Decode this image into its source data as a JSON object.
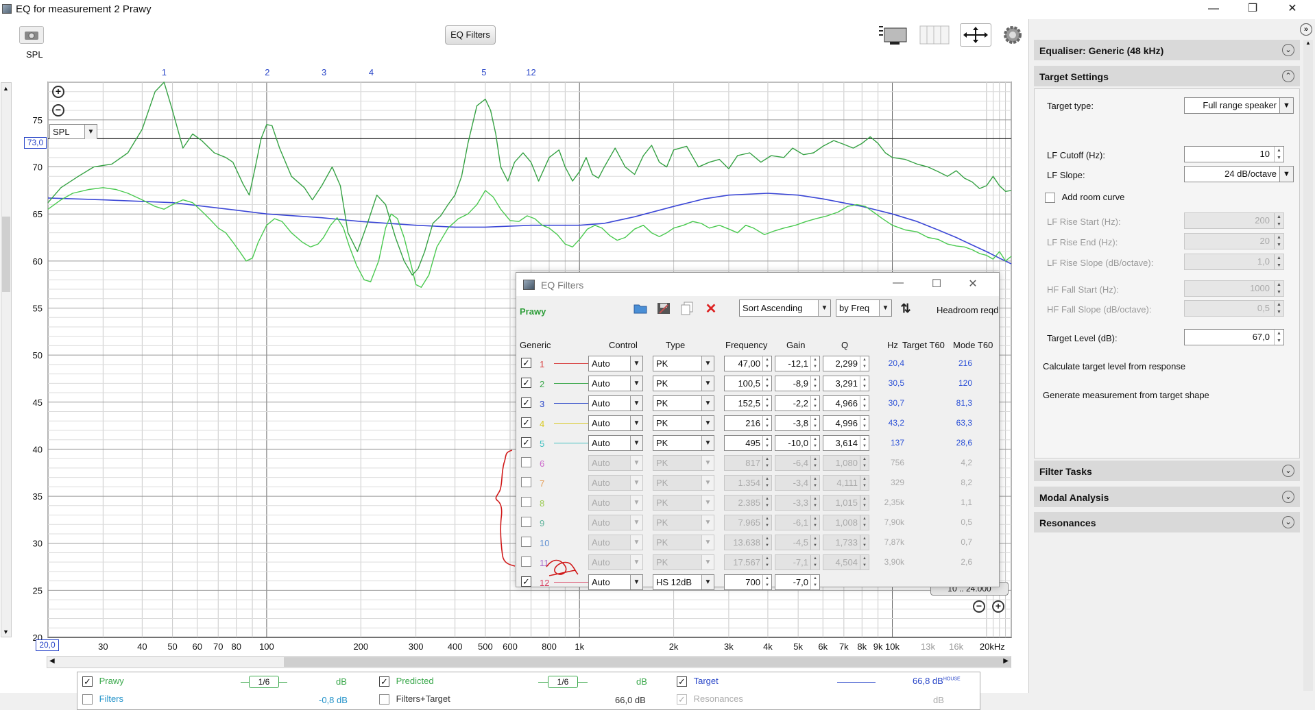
{
  "window": {
    "title": "EQ for measurement 2 Prawy",
    "min": "—",
    "max": "❐",
    "close": "✕"
  },
  "toolbar": {
    "eq_filters": "EQ Filters"
  },
  "graph": {
    "spl_label": "SPL",
    "spl_combo": "SPL",
    "y_ticks": [
      "75",
      "70",
      "65",
      "60",
      "55",
      "50",
      "45",
      "40",
      "35",
      "30",
      "25",
      "20"
    ],
    "y_marker": "73,0",
    "x_ticks": [
      "30",
      "40",
      "50",
      "60",
      "70",
      "80",
      "100",
      "200",
      "300",
      "400",
      "500",
      "600",
      "800",
      "1k",
      "2k",
      "3k",
      "4k",
      "5k",
      "6k",
      "7k",
      "8k",
      "9k",
      "10k",
      "13k",
      "16k",
      "20kHz"
    ],
    "x_start": "20,0",
    "filter_markers": [
      "1",
      "2",
      "3",
      "4",
      "5",
      "12"
    ],
    "range_label": "10 .. 24.000"
  },
  "legend": {
    "row1": [
      {
        "label": "Prawy",
        "smooth": "1/6",
        "unit": "dB",
        "color": "#3aa84b",
        "checked": true
      },
      {
        "label": "Predicted",
        "smooth": "1/6",
        "unit": "dB",
        "color": "#3aa84b",
        "checked": true
      },
      {
        "label": "Target",
        "value": "66,8 dB",
        "sup": "HOUSE",
        "color": "#2845c8",
        "checked": true
      }
    ],
    "row2": [
      {
        "label": "Filters",
        "value": "-0,8 dB",
        "color": "#1e90c8",
        "checked": false
      },
      {
        "label": "Filters+Target",
        "value": "66,0 dB",
        "checked": false
      },
      {
        "label": "Resonances",
        "value": "dB",
        "checked": true,
        "disabled": true
      }
    ]
  },
  "eq_dialog": {
    "title": "EQ Filters",
    "channel": "Prawy",
    "sort": "Sort Ascending",
    "by": "by Freq",
    "headroom": "Headroom reqd",
    "headers": {
      "generic": "Generic",
      "control": "Control",
      "type": "Type",
      "frequency": "Frequency",
      "gain": "Gain",
      "q": "Q",
      "hz": "Hz",
      "target_t60": "Target T60",
      "mode_t60": "Mode T60"
    },
    "filters": [
      {
        "n": "1",
        "color": "#d84040",
        "checked": true,
        "control": "Auto",
        "type": "PK",
        "freq": "47,00",
        "gain": "-12,1",
        "q": "2,299",
        "hz": "20,4",
        "mode": "216"
      },
      {
        "n": "2",
        "color": "#3aa84b",
        "checked": true,
        "control": "Auto",
        "type": "PK",
        "freq": "100,5",
        "gain": "-8,9",
        "q": "3,291",
        "hz": "30,5",
        "mode": "120"
      },
      {
        "n": "3",
        "color": "#2845c8",
        "checked": true,
        "control": "Auto",
        "type": "PK",
        "freq": "152,5",
        "gain": "-2,2",
        "q": "4,966",
        "hz": "30,7",
        "mode": "81,3"
      },
      {
        "n": "4",
        "color": "#d8c820",
        "checked": true,
        "control": "Auto",
        "type": "PK",
        "freq": "216",
        "gain": "-3,8",
        "q": "4,996",
        "hz": "43,2",
        "mode": "63,3"
      },
      {
        "n": "5",
        "color": "#40c0c0",
        "checked": true,
        "control": "Auto",
        "type": "PK",
        "freq": "495",
        "gain": "-10,0",
        "q": "3,614",
        "hz": "137",
        "mode": "28,6"
      },
      {
        "n": "6",
        "color": "#c040c0",
        "checked": false,
        "control": "Auto",
        "type": "PK",
        "freq": "817",
        "gain": "-6,4",
        "q": "1,080",
        "hz": "756",
        "mode": "4,2"
      },
      {
        "n": "7",
        "color": "#e08020",
        "checked": false,
        "control": "Auto",
        "type": "PK",
        "freq": "1.354",
        "gain": "-3,4",
        "q": "4,111",
        "hz": "329",
        "mode": "8,2"
      },
      {
        "n": "8",
        "color": "#80c020",
        "checked": false,
        "control": "Auto",
        "type": "PK",
        "freq": "2.385",
        "gain": "-3,3",
        "q": "1,015",
        "hz": "2,35k",
        "mode": "1,1"
      },
      {
        "n": "9",
        "color": "#30a080",
        "checked": false,
        "control": "Auto",
        "type": "PK",
        "freq": "7.965",
        "gain": "-6,1",
        "q": "1,008",
        "hz": "7,90k",
        "mode": "0,5"
      },
      {
        "n": "10",
        "color": "#3070c8",
        "checked": false,
        "control": "Auto",
        "type": "PK",
        "freq": "13.638",
        "gain": "-4,5",
        "q": "1,733",
        "hz": "7,87k",
        "mode": "0,7"
      },
      {
        "n": "11",
        "color": "#9040c0",
        "checked": false,
        "control": "Auto",
        "type": "PK",
        "freq": "17.567",
        "gain": "-7,1",
        "q": "4,504",
        "hz": "3,90k",
        "mode": "2,6"
      },
      {
        "n": "12",
        "color": "#d84060",
        "checked": true,
        "control": "Auto",
        "type": "HS 12dB",
        "freq": "700",
        "gain": "-7,0",
        "q": "",
        "hz": "",
        "mode": ""
      }
    ]
  },
  "right_panel": {
    "equaliser": "Equaliser: Generic (48 kHz)",
    "target_settings": "Target Settings",
    "target_type_label": "Target type:",
    "target_type": "Full range speaker",
    "lf_cutoff_label": "LF Cutoff (Hz):",
    "lf_cutoff": "10",
    "lf_slope_label": "LF Slope:",
    "lf_slope": "24 dB/octave",
    "add_room_curve": "Add room curve",
    "lf_rise_start_label": "LF Rise Start (Hz):",
    "lf_rise_start": "200",
    "lf_rise_end_label": "LF Rise End (Hz):",
    "lf_rise_end": "20",
    "lf_rise_slope_label": "LF Rise Slope (dB/octave):",
    "lf_rise_slope": "1,0",
    "hf_fall_start_label": "HF Fall Start (Hz):",
    "hf_fall_start": "1000",
    "hf_fall_slope_label": "HF Fall Slope (dB/octave):",
    "hf_fall_slope": "0,5",
    "target_level_label": "Target Level (dB):",
    "target_level": "67,0",
    "calc_target": "Calculate target level from response",
    "gen_measurement": "Generate measurement from target shape",
    "filter_tasks": "Filter Tasks",
    "modal_analysis": "Modal Analysis",
    "resonances": "Resonances"
  }
}
